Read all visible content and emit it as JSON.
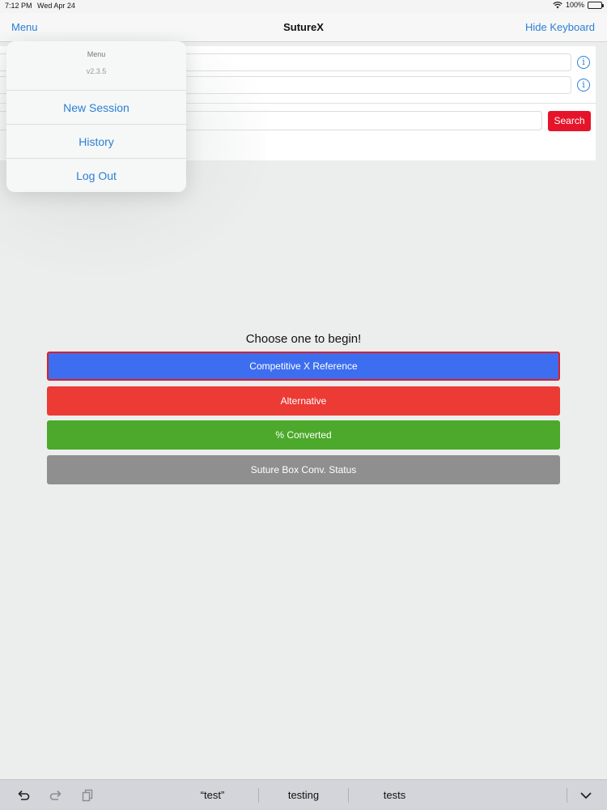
{
  "status_bar": {
    "time": "7:12 PM",
    "date": "Wed Apr 24",
    "battery": "100%",
    "battery_level": 1.0
  },
  "nav": {
    "menu_label": "Menu",
    "title": "SutureX",
    "hide_keyboard_label": "Hide Keyboard"
  },
  "form": {
    "search_label": "Search"
  },
  "popover": {
    "title": "Menu",
    "version": "v2.3.5",
    "items": [
      {
        "label": "New Session"
      },
      {
        "label": "History"
      },
      {
        "label": "Log Out"
      }
    ]
  },
  "main": {
    "prompt": "Choose one to begin!",
    "choices": [
      {
        "label": "Competitive X Reference",
        "color": "#3d6ef0",
        "selected": true
      },
      {
        "label": "Alternative",
        "color": "#ec3a35"
      },
      {
        "label": "% Converted",
        "color": "#4ca92b"
      },
      {
        "label": "Suture Box Conv. Status",
        "color": "#8f8f8f"
      }
    ]
  },
  "keyboard_bar": {
    "suggestions": [
      "“test”",
      "testing",
      "tests"
    ],
    "icons": [
      "undo-icon",
      "redo-icon",
      "paste-icon",
      "chevron-down-icon"
    ]
  },
  "colors": {
    "accent": "#2a7fd6",
    "search_button": "#e5142a",
    "selected_border": "#d9202a"
  }
}
